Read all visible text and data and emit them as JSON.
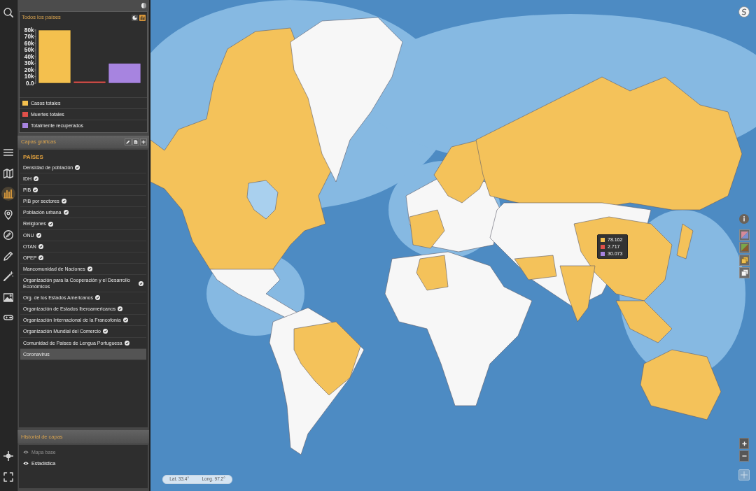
{
  "tool_rail": {
    "top": [
      {
        "kind": "search",
        "selected": false
      }
    ],
    "middle": [
      {
        "kind": "menu",
        "selected": false
      },
      {
        "kind": "map",
        "selected": false
      },
      {
        "kind": "chart",
        "selected": true
      },
      {
        "kind": "pin",
        "selected": false
      },
      {
        "kind": "pencil_circle",
        "selected": false
      },
      {
        "kind": "pencil",
        "selected": false
      },
      {
        "kind": "wand",
        "selected": false
      },
      {
        "kind": "image",
        "selected": false
      },
      {
        "kind": "gamepad",
        "selected": false
      }
    ],
    "bottom": [
      {
        "kind": "crosshair",
        "selected": false
      },
      {
        "kind": "fullscreen",
        "selected": false
      }
    ]
  },
  "chart_card": {
    "title": "Todos los países",
    "view_toggle": [
      {
        "kind": "pie",
        "selected": false
      },
      {
        "kind": "bar",
        "selected": true
      }
    ],
    "chart_data": {
      "type": "bar",
      "series": [
        {
          "name": "Casos totales",
          "color": "#f4c04e",
          "values": [
            80000
          ]
        },
        {
          "name": "Muertes totales",
          "color": "#e0504a",
          "values": [
            3000
          ]
        },
        {
          "name": "Totalmente recuperados",
          "color": "#a784e0",
          "values": [
            30000
          ]
        }
      ],
      "ylim": [
        0,
        80000
      ],
      "yticks": [
        {
          "value": 0,
          "label": "0.0"
        },
        {
          "value": 10000,
          "label": "10k"
        },
        {
          "value": 20000,
          "label": "20k"
        },
        {
          "value": 30000,
          "label": "30k"
        },
        {
          "value": 40000,
          "label": "40k"
        },
        {
          "value": 50000,
          "label": "50k"
        },
        {
          "value": 60000,
          "label": "60k"
        },
        {
          "value": 70000,
          "label": "70k"
        },
        {
          "value": 80000,
          "label": "80k"
        }
      ]
    }
  },
  "layers_panel": {
    "title": "Capas gráficas",
    "section": "PAÍSES",
    "items": [
      {
        "label": "Densidad de población",
        "checked": true,
        "selected": false
      },
      {
        "label": "IDH",
        "checked": true,
        "selected": false
      },
      {
        "label": "PIB",
        "checked": true,
        "selected": false
      },
      {
        "label": "PIB por sectores",
        "checked": true,
        "selected": false
      },
      {
        "label": "Población urbana",
        "checked": true,
        "selected": false
      },
      {
        "label": "Religiones",
        "checked": true,
        "selected": false
      },
      {
        "label": "ONU",
        "checked": true,
        "selected": false
      },
      {
        "label": "OTAN",
        "checked": true,
        "selected": false
      },
      {
        "label": "OPEP",
        "checked": true,
        "selected": false
      },
      {
        "label": "Mancomunidad de Naciones",
        "checked": true,
        "selected": false
      },
      {
        "label": "Organización para la Cooperación y el Desarrollo Económicos",
        "checked": true,
        "selected": false
      },
      {
        "label": "Org. de los Estados Americanos",
        "checked": true,
        "selected": false
      },
      {
        "label": "Organización de Estados Iberoamericanos",
        "checked": true,
        "selected": false
      },
      {
        "label": "Organización Internacional de la Francofonía",
        "checked": true,
        "selected": false
      },
      {
        "label": "Organización Mundial del Comercio",
        "checked": true,
        "selected": false
      },
      {
        "label": "Comunidad de Países de Lengua Portuguesa",
        "checked": true,
        "selected": false
      },
      {
        "label": "Coronavirus",
        "checked": false,
        "selected": true
      }
    ]
  },
  "history_panel": {
    "title": "Historial de capas",
    "items": [
      {
        "label": "Mapa base",
        "active": false
      },
      {
        "label": "Estadística",
        "active": true
      }
    ]
  },
  "map": {
    "tooltip": [
      {
        "value": "78.162",
        "color": "#f4c04e"
      },
      {
        "value": "2.717",
        "color": "#e0504a"
      },
      {
        "value": "30.073",
        "color": "#a784e0"
      }
    ],
    "coordinates": {
      "lat": "Lat. 33.4°",
      "long": "Long. 97.2°"
    }
  }
}
